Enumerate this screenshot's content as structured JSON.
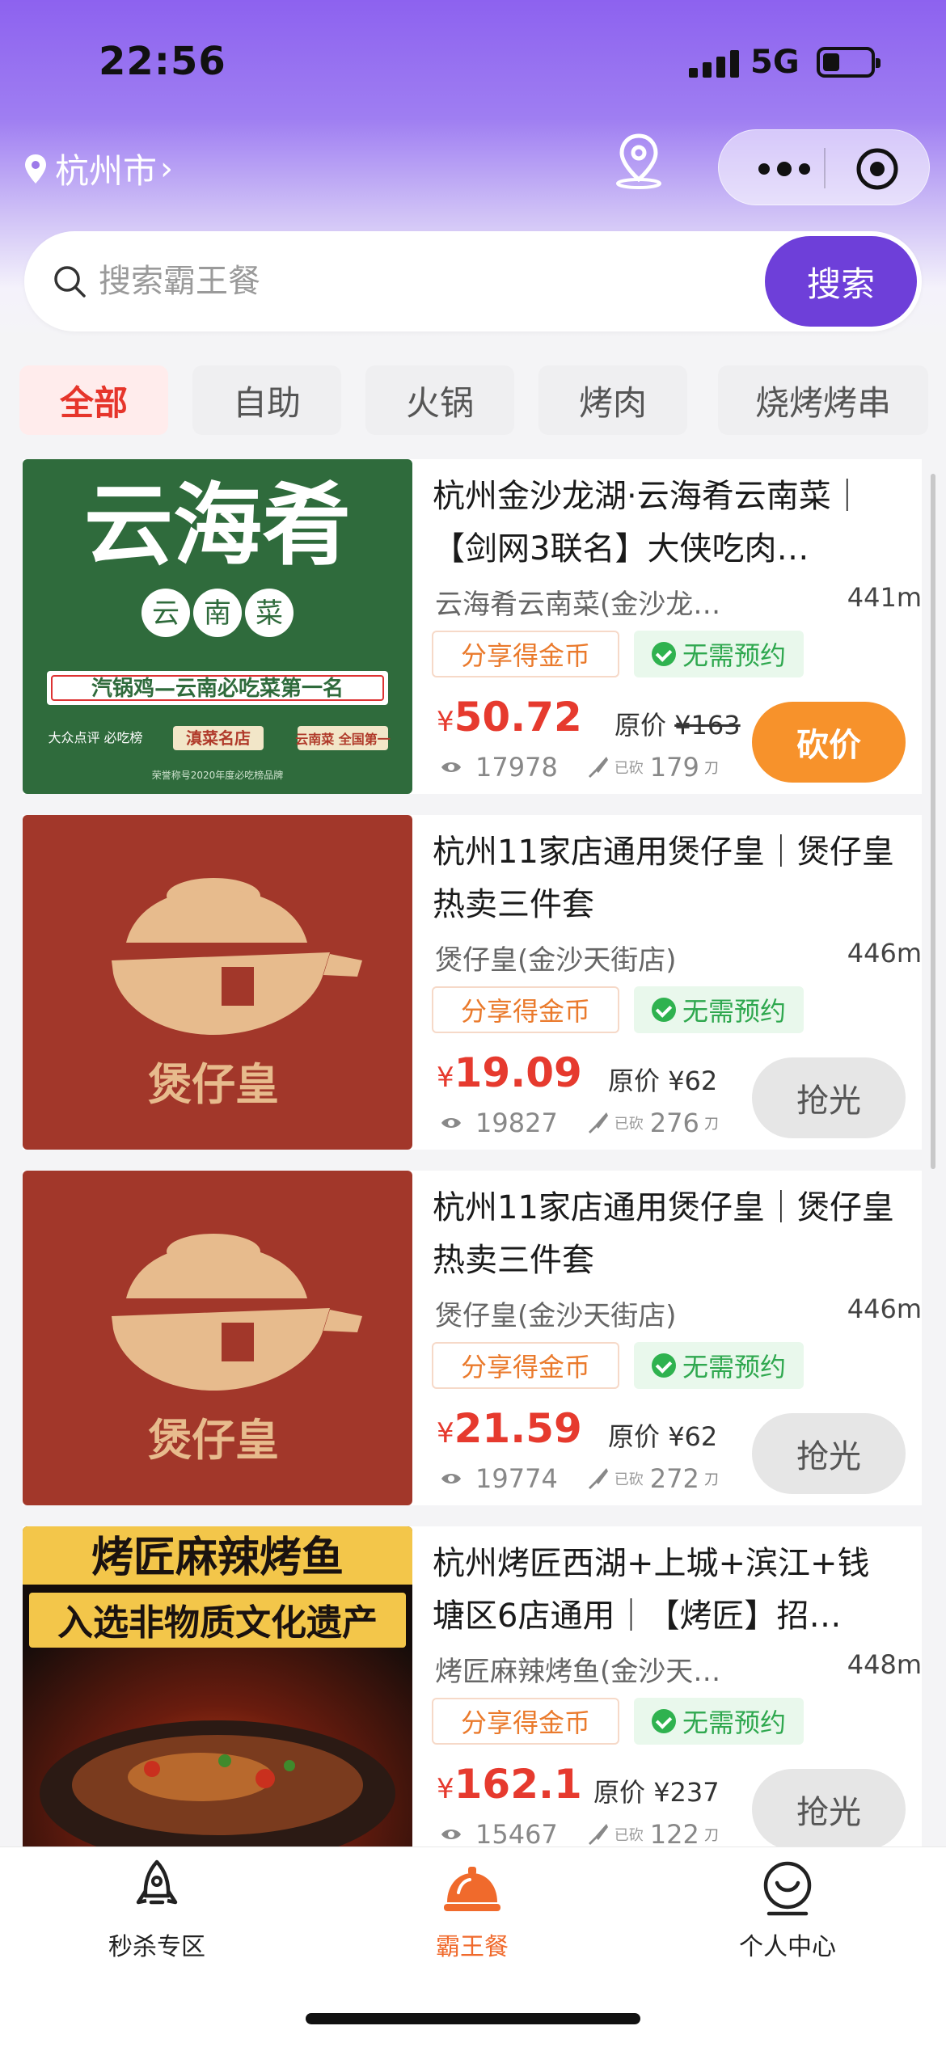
{
  "status_bar": {
    "time": "22:56",
    "network": "5G"
  },
  "header": {
    "city": "杭州市",
    "city_chevron": "›",
    "map_icon": "location-pin-icon",
    "menu_icon": "more-dots-icon",
    "close_icon": "target-circle-icon"
  },
  "search": {
    "placeholder": "搜索霸王餐",
    "button_label": "搜索"
  },
  "tabs": [
    {
      "label": "全部",
      "active": true
    },
    {
      "label": "自助",
      "active": false
    },
    {
      "label": "火锅",
      "active": false
    },
    {
      "label": "烤肉",
      "active": false
    },
    {
      "label": "烧烤烤串",
      "active": false
    }
  ],
  "deals": [
    {
      "title": "杭州金沙龙湖·云海肴云南菜｜【剑网3联名】大侠吃肉…",
      "store": "云海肴云南菜(金沙龙…",
      "distance": "441m",
      "tag_share": "分享得金币",
      "tag_reservation": "无需预约",
      "price": "50.72",
      "currency": "¥",
      "original_label": "原价",
      "original_price": "¥163",
      "original_struck": true,
      "views": "17978",
      "bargain_label": "已砍",
      "bargain_count": "179",
      "bargain_unit": "刀",
      "button": "砍价",
      "button_state": "bargain",
      "thumb": {
        "type": "yunhaiyao",
        "bg_color": "#2f6b3c",
        "logo_text": "云海肴",
        "sub_chars": [
          "云",
          "南",
          "菜"
        ],
        "banner": "汽锅鸡—云南必吃菜第一名",
        "badges": [
          "大众点评 必吃榜",
          "滇菜名店",
          "云南菜 全国第一"
        ],
        "footnote": "荣誉称号2020年度必吃榜品牌"
      }
    },
    {
      "title": "杭州11家店通用煲仔皇｜煲仔皇热卖三件套",
      "store": "煲仔皇(金沙天街店)",
      "distance": "446m",
      "tag_share": "分享得金币",
      "tag_reservation": "无需预约",
      "price": "19.09",
      "currency": "¥",
      "original_label": "原价",
      "original_price": "¥62",
      "original_struck": false,
      "views": "19827",
      "bargain_label": "已砍",
      "bargain_count": "276",
      "bargain_unit": "刀",
      "button": "抢光",
      "button_state": "soldout",
      "thumb": {
        "type": "baozaihuang",
        "bg_color": "#a2372a",
        "logo_text": "煲仔皇"
      }
    },
    {
      "title": "杭州11家店通用煲仔皇｜煲仔皇热卖三件套",
      "store": "煲仔皇(金沙天街店)",
      "distance": "446m",
      "tag_share": "分享得金币",
      "tag_reservation": "无需预约",
      "price": "21.59",
      "currency": "¥",
      "original_label": "原价",
      "original_price": "¥62",
      "original_struck": false,
      "views": "19774",
      "bargain_label": "已砍",
      "bargain_count": "272",
      "bargain_unit": "刀",
      "button": "抢光",
      "button_state": "soldout",
      "thumb": {
        "type": "baozaihuang",
        "bg_color": "#a2372a",
        "logo_text": "煲仔皇"
      }
    },
    {
      "title": "杭州烤匠西湖+上城+滨江+钱塘区6店通用｜【烤匠】招…",
      "store": "烤匠麻辣烤鱼(金沙天…",
      "distance": "448m",
      "tag_share": "分享得金币",
      "tag_reservation": "无需预约",
      "price": "162.1",
      "currency": "¥",
      "original_label": "原价",
      "original_price": "¥237",
      "original_struck": false,
      "views": "15467",
      "bargain_label": "已砍",
      "bargain_count": "122",
      "bargain_unit": "刀",
      "button": "抢光",
      "button_state": "soldout",
      "thumb": {
        "type": "kaojiang",
        "bg_color": "#1a1210",
        "line1": "烤匠麻辣烤鱼",
        "line2": "入选非物质文化遗产"
      }
    }
  ],
  "bottom_nav": [
    {
      "label": "秒杀专区",
      "icon": "rocket-icon",
      "active": false
    },
    {
      "label": "霸王餐",
      "icon": "food-cloche-icon",
      "active": true
    },
    {
      "label": "个人中心",
      "icon": "smiley-profile-icon",
      "active": false
    }
  ],
  "colors": {
    "accent_purple": "#6e3fd9",
    "price_red": "#e63a2e",
    "bargain_orange": "#f7922b",
    "active_tab_red": "#e6352b",
    "nav_active": "#f06a2c"
  }
}
